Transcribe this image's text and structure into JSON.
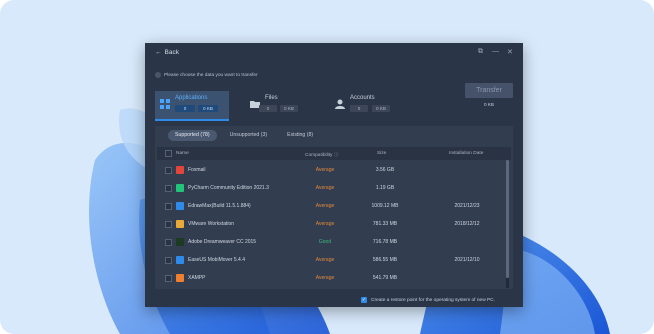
{
  "window": {
    "back_label": "Back",
    "hint": "Please choose the data you want to transfer",
    "transfer_label": "Transfer",
    "transfer_size": "0 KB"
  },
  "categories": [
    {
      "label": "Applications",
      "count": "0",
      "size": "0 KB",
      "icon": "applications-icon"
    },
    {
      "label": "Files",
      "count": "0",
      "size": "0 KB",
      "icon": "folder-icon"
    },
    {
      "label": "Accounts",
      "count": "0",
      "size": "0 KB",
      "icon": "account-icon"
    }
  ],
  "tabs": [
    {
      "label": "Supported (78)"
    },
    {
      "label": "Unsupported (3)"
    },
    {
      "label": "Existing (8)"
    }
  ],
  "columns": {
    "name": "Name",
    "compatibility": "Compatibility",
    "size": "Size",
    "date": "Installation Date"
  },
  "rows": [
    {
      "name": "Foxmail",
      "compatibility": "Average",
      "size": "3.56 GB",
      "date": "",
      "icon_color": "#e2463a"
    },
    {
      "name": "PyCharm Community Edition 2021.3",
      "compatibility": "Average",
      "size": "1.19 GB",
      "date": "",
      "icon_color": "#21c47a"
    },
    {
      "name": "EdrawMax(Build 11.5.1.884)",
      "compatibility": "Average",
      "size": "1009.12 MB",
      "date": "2021/12/23",
      "icon_color": "#2f8bea"
    },
    {
      "name": "VMware Workstation",
      "compatibility": "Average",
      "size": "781.33 MB",
      "date": "2018/12/12",
      "icon_color": "#e8a83a"
    },
    {
      "name": "Adobe Dreamweaver CC 2015",
      "compatibility": "Good",
      "size": "716.78 MB",
      "date": "",
      "icon_color": "#1d3b22"
    },
    {
      "name": "EaseUS MobiMover 5.4.4",
      "compatibility": "Average",
      "size": "586.55 MB",
      "date": "2021/12/10",
      "icon_color": "#2f8bea"
    },
    {
      "name": "XAMPP",
      "compatibility": "Average",
      "size": "541.79 MB",
      "date": "",
      "icon_color": "#f08030"
    }
  ],
  "restore_label": "Create a restore point for the operating system of new PC."
}
